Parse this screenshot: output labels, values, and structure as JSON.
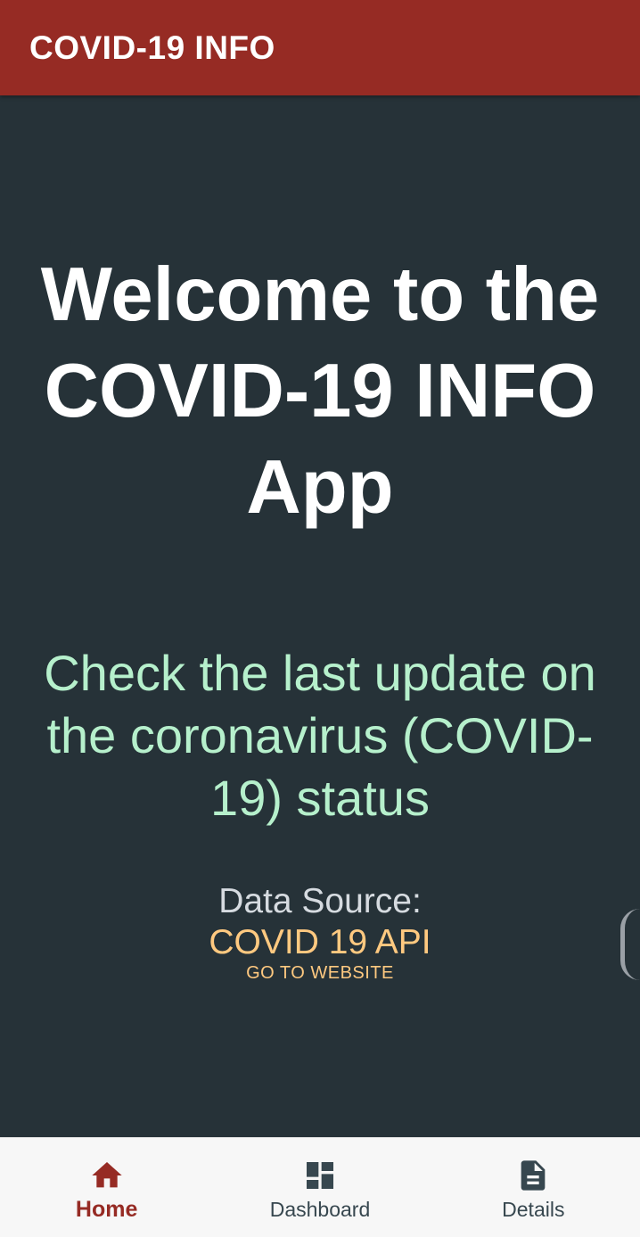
{
  "app_bar": {
    "title": "COVID-19 INFO"
  },
  "main": {
    "welcome_text": "Welcome to the COVID-19 INFO App",
    "subtitle": "Check the last update on the coronavirus (COVID-19) status",
    "data_source_label": "Data Source:",
    "data_source_name": "COVID 19 API",
    "website_link_label": "GO TO WEBSITE"
  },
  "bottom_nav": {
    "items": [
      {
        "label": "Home",
        "icon": "home-icon",
        "active": true
      },
      {
        "label": "Dashboard",
        "icon": "dashboard-icon",
        "active": false
      },
      {
        "label": "Details",
        "icon": "document-icon",
        "active": false
      }
    ]
  },
  "colors": {
    "app_bar": "#962b24",
    "background": "#263238",
    "subtitle": "#b6f0cc",
    "accent_link": "#ffc980",
    "nav_active": "#962b24",
    "nav_inactive": "#37474f"
  }
}
